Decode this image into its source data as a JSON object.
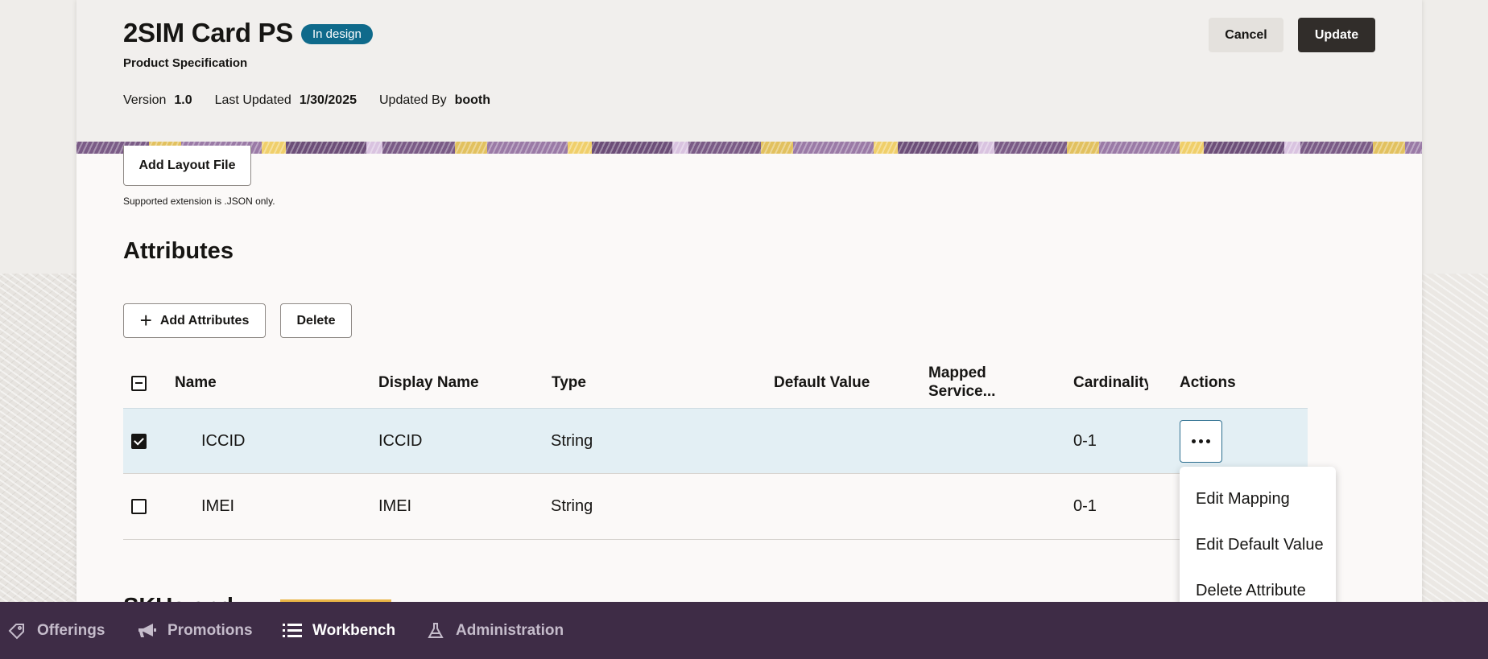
{
  "header": {
    "title": "2SIM Card PS",
    "status_badge": "In design",
    "subtitle": "Product Specification",
    "version_label": "Version",
    "version_value": "1.0",
    "last_updated_label": "Last Updated",
    "last_updated_value": "1/30/2025",
    "updated_by_label": "Updated By",
    "updated_by_value": "booth",
    "cancel_label": "Cancel",
    "update_label": "Update"
  },
  "layout_file": {
    "add_button_label": "Add Layout File",
    "hint": "Supported extension is .JSON only."
  },
  "attributes": {
    "section_title": "Attributes",
    "add_button_label": "Add Attributes",
    "delete_button_label": "Delete",
    "columns": {
      "name": "Name",
      "display_name": "Display Name",
      "type": "Type",
      "default_value": "Default Value",
      "mapped_service_line1": "Mapped",
      "mapped_service_line2": "Service...",
      "cardinality": "Cardinality",
      "actions": "Actions"
    },
    "rows": [
      {
        "checked": true,
        "name": "ICCID",
        "display_name": "ICCID",
        "type": "String",
        "default_value": "",
        "mapped_service": "",
        "cardinality": "0-1"
      },
      {
        "checked": false,
        "name": "IMEI",
        "display_name": "IMEI",
        "type": "String",
        "default_value": "",
        "mapped_service": "",
        "cardinality": "0-1"
      }
    ]
  },
  "actions_menu": {
    "items": [
      "Edit Mapping",
      "Edit Default Value",
      "Delete Attribute"
    ]
  },
  "next_section_peek": "SKUs and",
  "bottom_nav": {
    "items": [
      {
        "label": "Offerings",
        "icon": "tag-icon",
        "active": false
      },
      {
        "label": "Promotions",
        "icon": "megaphone-icon",
        "active": false
      },
      {
        "label": "Workbench",
        "icon": "list-icon",
        "active": true
      },
      {
        "label": "Administration",
        "icon": "flask-icon",
        "active": false
      }
    ]
  },
  "colors": {
    "badge": "#0f6a8b",
    "nav_bg": "#3e2c46",
    "selected_row": "#e3eff4",
    "update_button": "#312d2a"
  }
}
